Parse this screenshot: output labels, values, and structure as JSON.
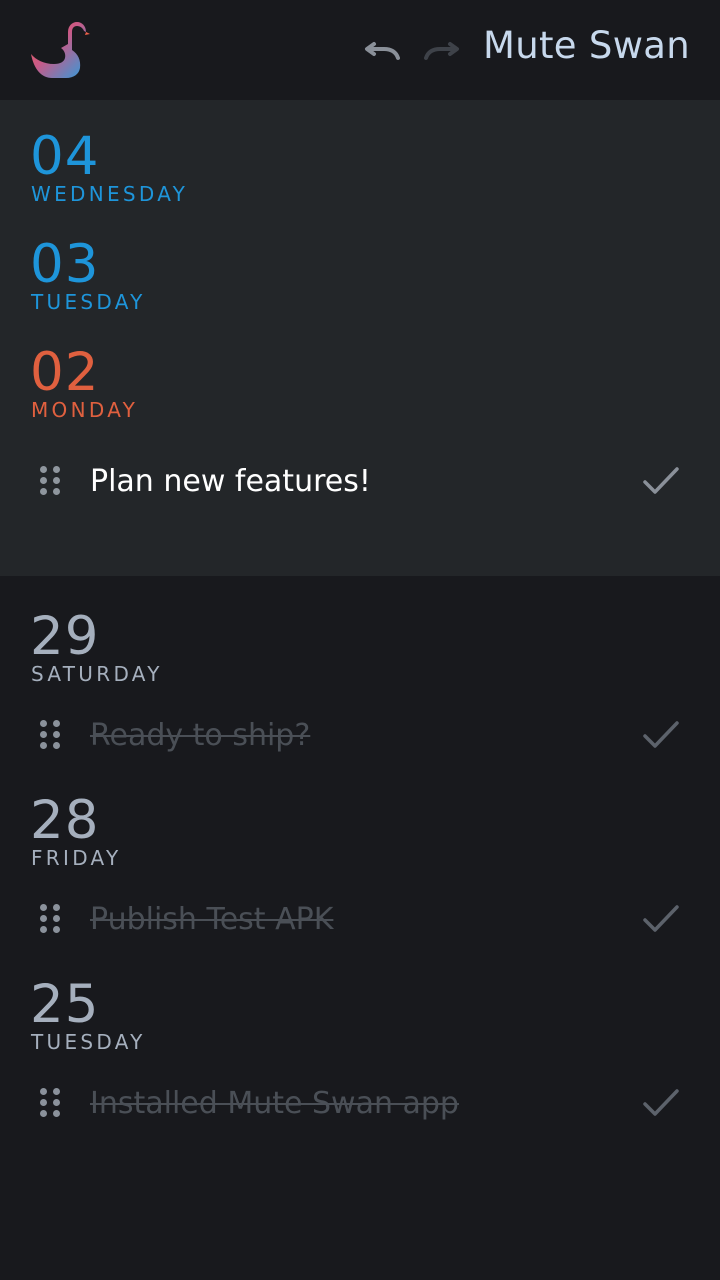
{
  "header": {
    "app_title": "Mute Swan",
    "logo_icon": "swan-logo-icon",
    "undo_icon": "undo-icon",
    "redo_icon": "redo-icon"
  },
  "colors": {
    "background": "#18191d",
    "current_section_bg": "#232629",
    "accent_blue": "#1e95da",
    "accent_orange": "#e0603f",
    "past_day_gray": "#a5afbd",
    "title": "#c7d8ec"
  },
  "current": {
    "days": [
      {
        "number": "04",
        "name": "WEDNESDAY",
        "color": "blue"
      },
      {
        "number": "03",
        "name": "TUESDAY",
        "color": "blue"
      },
      {
        "number": "02",
        "name": "MONDAY",
        "color": "orange"
      }
    ],
    "tasks": [
      {
        "text": "Plan new features!",
        "done": false
      }
    ]
  },
  "past": {
    "entries": [
      {
        "number": "29",
        "name": "SATURDAY",
        "task": "Ready to ship?",
        "done": true
      },
      {
        "number": "28",
        "name": "FRIDAY",
        "task": "Publish Test APK",
        "done": true
      },
      {
        "number": "25",
        "name": "TUESDAY",
        "task": "Installed Mute Swan app",
        "done": true
      }
    ]
  }
}
